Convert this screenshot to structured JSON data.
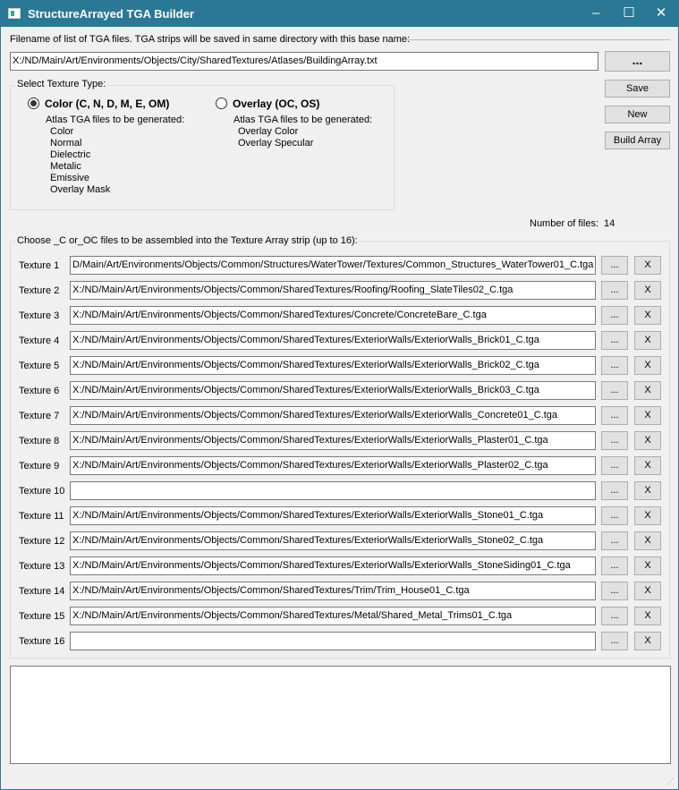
{
  "window": {
    "title": "StructureArrayed TGA Builder",
    "minimize": "–",
    "maximize": "☐",
    "close": "✕"
  },
  "filename": {
    "label": "Filename of list of TGA files. TGA strips will be saved in same directory with this base name:",
    "value": "X:/ND/Main/Art/Environments/Objects/City/SharedTextures/Atlases/BuildingArray.txt",
    "browse": "..."
  },
  "buttons": {
    "save": "Save",
    "new": "New",
    "build": "Build Array"
  },
  "texture_type": {
    "label": "Select Texture Type:",
    "color": {
      "label": "Color (C, N, D, M, E, OM)",
      "selected": true,
      "heading": "Atlas TGA files to be generated:",
      "files": [
        "Color",
        "Normal",
        "Dielectric",
        "Metalic",
        "Emissive",
        "Overlay Mask"
      ]
    },
    "overlay": {
      "label": "Overlay (OC, OS)",
      "selected": false,
      "heading": "Atlas TGA files to be generated:",
      "files": [
        "Overlay Color",
        "Overlay Specular"
      ]
    }
  },
  "num_files": {
    "label": "Number of files:",
    "value": "14"
  },
  "textures": {
    "label": "Choose _C or_OC files to be assembled into the Texture Array strip (up to 16):",
    "browse": "...",
    "clear": "X",
    "rows": [
      {
        "label": "Texture 1",
        "value": "D/Main/Art/Environments/Objects/Common/Structures/WaterTower/Textures/Common_Structures_WaterTower01_C.tga"
      },
      {
        "label": "Texture 2",
        "value": "X:/ND/Main/Art/Environments/Objects/Common/SharedTextures/Roofing/Roofing_SlateTiles02_C.tga"
      },
      {
        "label": "Texture 3",
        "value": "X:/ND/Main/Art/Environments/Objects/Common/SharedTextures/Concrete/ConcreteBare_C.tga"
      },
      {
        "label": "Texture 4",
        "value": "X:/ND/Main/Art/Environments/Objects/Common/SharedTextures/ExteriorWalls/ExteriorWalls_Brick01_C.tga"
      },
      {
        "label": "Texture 5",
        "value": "X:/ND/Main/Art/Environments/Objects/Common/SharedTextures/ExteriorWalls/ExteriorWalls_Brick02_C.tga"
      },
      {
        "label": "Texture 6",
        "value": "X:/ND/Main/Art/Environments/Objects/Common/SharedTextures/ExteriorWalls/ExteriorWalls_Brick03_C.tga"
      },
      {
        "label": "Texture 7",
        "value": "X:/ND/Main/Art/Environments/Objects/Common/SharedTextures/ExteriorWalls/ExteriorWalls_Concrete01_C.tga"
      },
      {
        "label": "Texture 8",
        "value": "X:/ND/Main/Art/Environments/Objects/Common/SharedTextures/ExteriorWalls/ExteriorWalls_Plaster01_C.tga"
      },
      {
        "label": "Texture 9",
        "value": "X:/ND/Main/Art/Environments/Objects/Common/SharedTextures/ExteriorWalls/ExteriorWalls_Plaster02_C.tga"
      },
      {
        "label": "Texture 10",
        "value": ""
      },
      {
        "label": "Texture 11",
        "value": "X:/ND/Main/Art/Environments/Objects/Common/SharedTextures/ExteriorWalls/ExteriorWalls_Stone01_C.tga"
      },
      {
        "label": "Texture 12",
        "value": "X:/ND/Main/Art/Environments/Objects/Common/SharedTextures/ExteriorWalls/ExteriorWalls_Stone02_C.tga"
      },
      {
        "label": "Texture 13",
        "value": "X:/ND/Main/Art/Environments/Objects/Common/SharedTextures/ExteriorWalls/ExteriorWalls_StoneSiding01_C.tga"
      },
      {
        "label": "Texture 14",
        "value": "X:/ND/Main/Art/Environments/Objects/Common/SharedTextures/Trim/Trim_House01_C.tga"
      },
      {
        "label": "Texture 15",
        "value": "X:/ND/Main/Art/Environments/Objects/Common/SharedTextures/Metal/Shared_Metal_Trims01_C.tga"
      },
      {
        "label": "Texture 16",
        "value": ""
      }
    ]
  },
  "output": {
    "value": ""
  }
}
